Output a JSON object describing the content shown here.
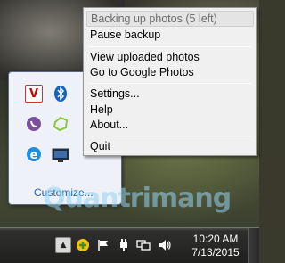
{
  "context_menu": {
    "status": "Backing up photos (5 left)",
    "pause": "Pause backup",
    "view_uploaded": "View uploaded photos",
    "go_to": "Go to Google Photos",
    "settings": "Settings...",
    "help": "Help",
    "about": "About...",
    "quit": "Quit"
  },
  "tray_overflow": {
    "customize": "Customize...",
    "icons": [
      "vipre-icon",
      "bluetooth-icon",
      "viber-icon",
      "greenshot-icon",
      "ie-icon",
      "display-icon"
    ]
  },
  "taskbar": {
    "time": "10:20 AM",
    "date": "7/13/2015"
  },
  "watermark": "Quantrimang",
  "colors": {
    "menu_bg": "#f0f0f0",
    "link_blue": "#1d62b5",
    "taskbar": "#1f1f1e"
  }
}
